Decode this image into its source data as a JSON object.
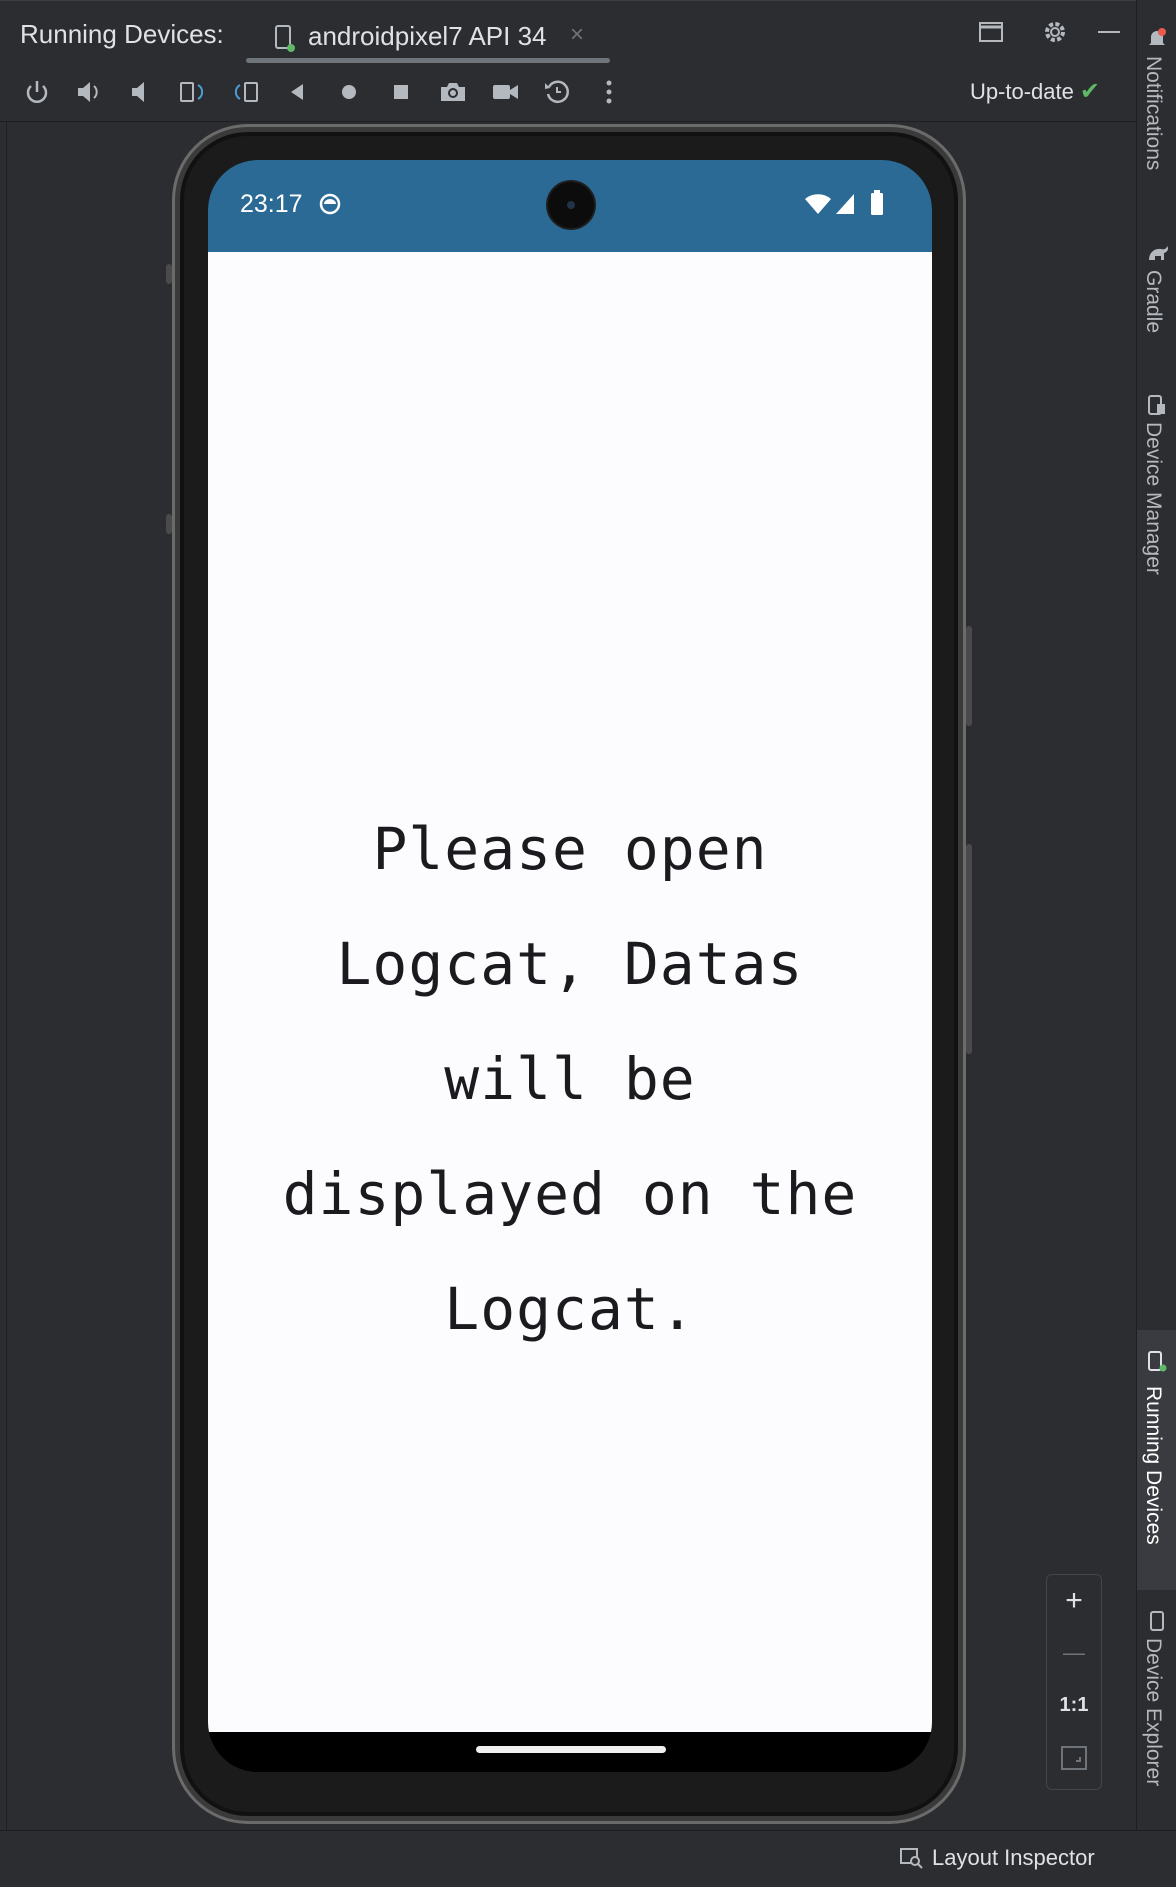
{
  "header": {
    "title": "Running Devices:",
    "tab_label": "androidpixel7 API 34",
    "tab_close": "×"
  },
  "toolbar": {
    "status": "Up-to-date",
    "status_check": "✔",
    "buttons": [
      "power-icon",
      "volume-up-icon",
      "volume-down-icon",
      "rotate-left-icon",
      "rotate-right-icon",
      "back-icon",
      "home-icon",
      "overview-icon",
      "screenshot-icon",
      "screen-record-icon",
      "reset-icon",
      "more-icon"
    ]
  },
  "device": {
    "time": "23:17",
    "message_lines": [
      "Please open",
      "Logcat, Datas",
      "will be",
      "displayed on the",
      "Logcat."
    ]
  },
  "right_panel": {
    "notifications": "Notifications",
    "gradle": "Gradle",
    "device_manager": "Device Manager",
    "running_devices": "Running Devices",
    "device_explorer": "Device Explorer"
  },
  "zoom": {
    "zoom_in": "+",
    "zoom_out": "—",
    "actual_size": "1:1"
  },
  "bottom": {
    "layout_inspector": "Layout Inspector"
  },
  "colors": {
    "ide_bg": "#2b2d30",
    "status_bar": "#2a6a94",
    "app_bg": "#fcfcff",
    "accent_check": "#5fb865"
  }
}
